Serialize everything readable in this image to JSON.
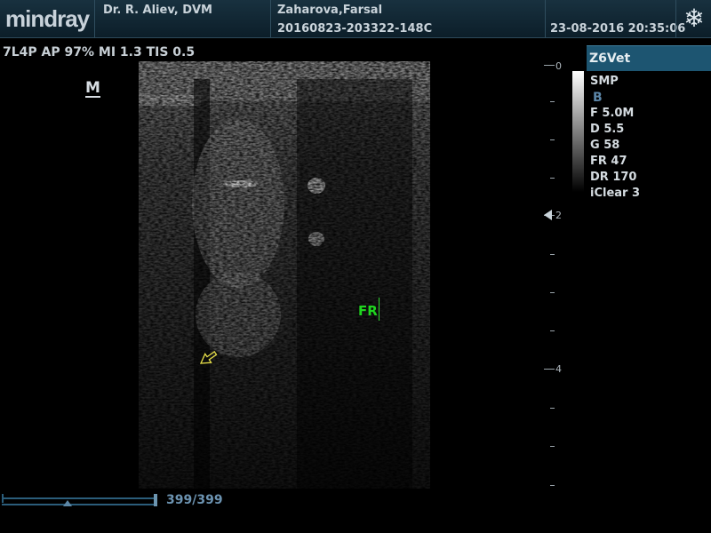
{
  "header": {
    "logo": "mindray",
    "operator": "Dr. R. Aliev, DVM",
    "patient_name": "Zaharova,Farsal",
    "exam_id": "20160823-203322-148C",
    "date_time": "23-08-2016  20:35:06",
    "freeze_icon": "snowflake-icon"
  },
  "probe_info": "7L4P  AP 97%  MI 1.3  TIS 0.5",
  "orientation_mark": "M",
  "annotation": {
    "text": "FR",
    "color": "#1fd51f"
  },
  "depth_scale": {
    "labels": [
      "0",
      "2",
      "4"
    ]
  },
  "right_panel": {
    "model": "Z6Vet",
    "params": [
      "SMP",
      "B",
      "F 5.0M",
      "D 5.5",
      "G 58",
      "FR 47",
      "DR 170",
      "iClear 3"
    ]
  },
  "cine": {
    "frame_counter": "399/399"
  },
  "colors": {
    "header_bg": "#0c1e29",
    "accent_blue": "#1d5571",
    "annotation_green": "#1fd51f"
  }
}
